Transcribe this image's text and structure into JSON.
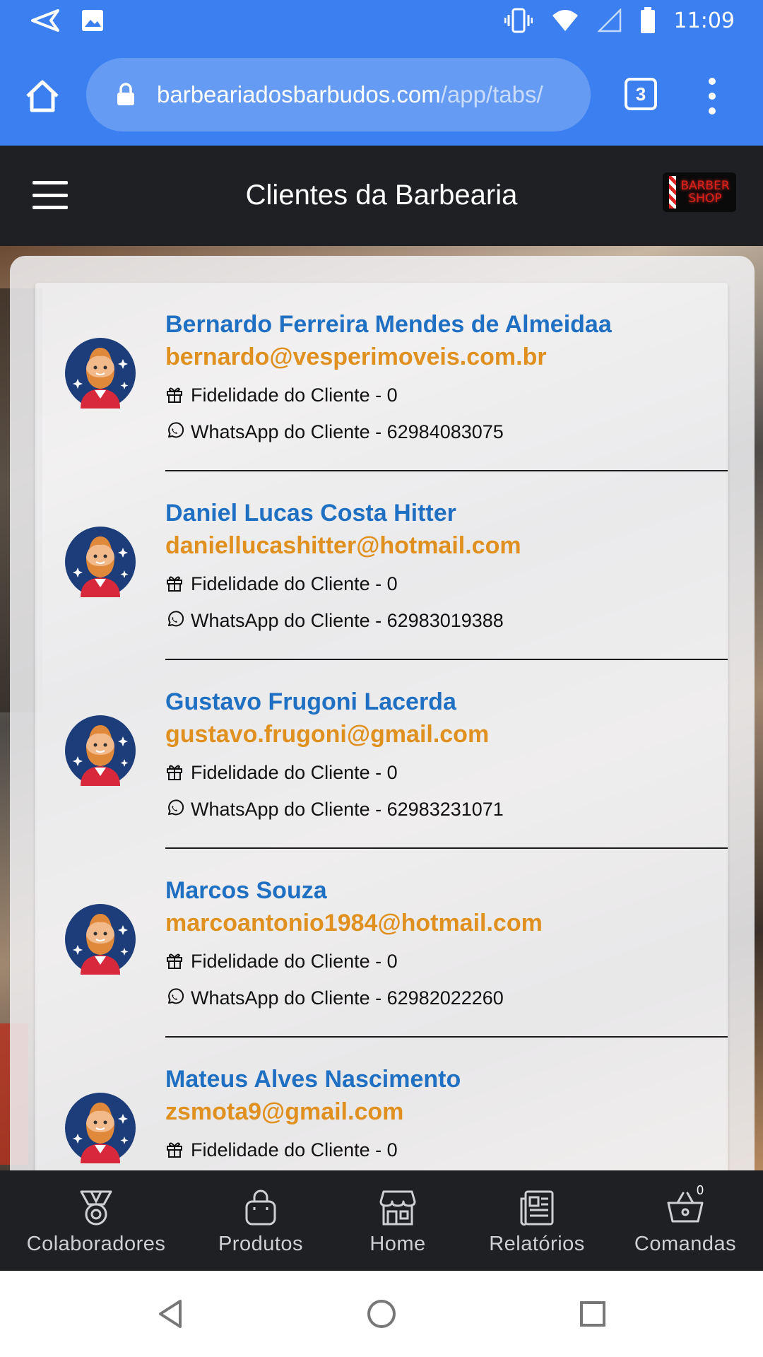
{
  "status_bar": {
    "time": "11:09",
    "left_icons": [
      "send-icon",
      "image-icon"
    ],
    "right_icons": [
      "vibrate-icon",
      "wifi-icon",
      "signal-icon",
      "battery-icon"
    ]
  },
  "browser": {
    "url_host": "barbeariadosbarbudos.com",
    "url_path": "/app/tabs/",
    "tab_count": "3"
  },
  "header": {
    "title": "Clientes da Barbearia",
    "logo_line1": "BARBER",
    "logo_line2": "SHOP"
  },
  "clients": [
    {
      "name": "Bernardo Ferreira Mendes de Almeidaa",
      "email": "bernardo@vesperimoveis.com.br",
      "fidelity_label": "Fidelidade do Cliente - 0",
      "whatsapp_label": "WhatsApp do Cliente - 62984083075"
    },
    {
      "name": "Daniel Lucas Costa Hitter",
      "email": "daniellucashitter@hotmail.com",
      "fidelity_label": "Fidelidade do Cliente - 0",
      "whatsapp_label": "WhatsApp do Cliente - 62983019388"
    },
    {
      "name": "Gustavo Frugoni Lacerda",
      "email": "gustavo.frugoni@gmail.com",
      "fidelity_label": "Fidelidade do Cliente - 0",
      "whatsapp_label": "WhatsApp do Cliente - 62983231071"
    },
    {
      "name": "Marcos Souza",
      "email": "marcoantonio1984@hotmail.com",
      "fidelity_label": "Fidelidade do Cliente - 0",
      "whatsapp_label": "WhatsApp do Cliente - 62982022260"
    },
    {
      "name": "Mateus Alves Nascimento",
      "email": "zsmota9@gmail.com",
      "fidelity_label": "Fidelidade do Cliente - 0",
      "whatsapp_label": ""
    }
  ],
  "tabs": [
    {
      "label": "Colaboradores",
      "icon": "medal-icon"
    },
    {
      "label": "Produtos",
      "icon": "shopping-bag-icon"
    },
    {
      "label": "Home",
      "icon": "storefront-icon"
    },
    {
      "label": "Relatórios",
      "icon": "newspaper-icon"
    },
    {
      "label": "Comandas",
      "icon": "basket-icon",
      "badge": "0"
    }
  ],
  "colors": {
    "browser_blue": "#3b7ff0",
    "header_dark": "#1f2024",
    "name_blue": "#1f6fc2",
    "email_orange": "#e0901e"
  }
}
